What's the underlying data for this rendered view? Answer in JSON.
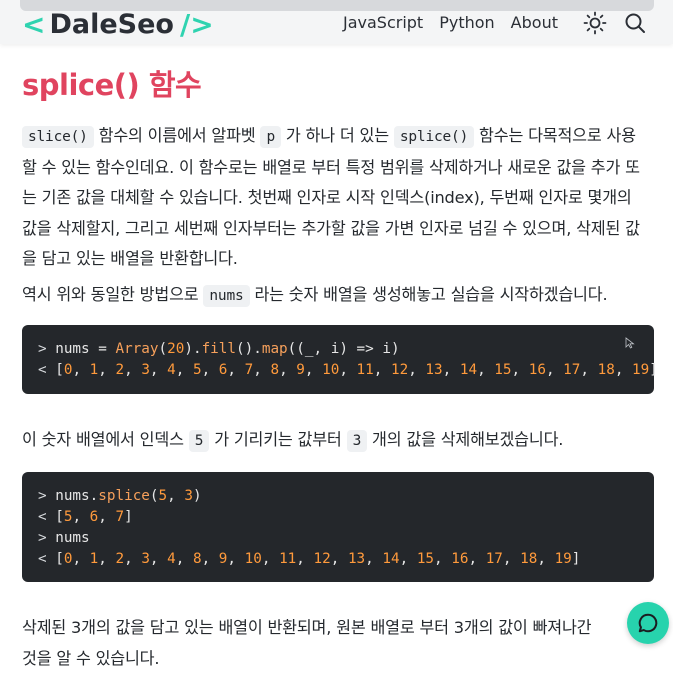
{
  "header": {
    "logo": {
      "left_bracket": "<",
      "name": "DaleSeo",
      "right_bracket": "/>"
    },
    "nav": [
      "JavaScript",
      "Python",
      "About"
    ],
    "icons": [
      "sun-icon",
      "search-icon"
    ]
  },
  "article": {
    "title": "splice() 함수",
    "p1": {
      "c1": "slice()",
      "t1": " 함수의 이름에서 알파벳 ",
      "c2": "p",
      "t2": " 가 하나 더 있는 ",
      "c3": "splice()",
      "t3": " 함수는 다목적으로 사용할 수 있는 함수인데요. 이 함수로는 배열로 부터 특정 범위를 삭제하거나 새로운 값을 추가 또는 기존 값을 대체할 수 있습니다. 첫번째 인자로 시작 인덱스(index), 두번째 인자로 몇개의 값을 삭제할지, 그리고 세번째 인자부터는 추가할 값을 가변 인자로 넘길 수 있으며, 삭제된 값을 담고 있는 배열을 반환합니다."
    },
    "p2": {
      "t1": "역시 위와 동일한 방법으로 ",
      "c1": "nums",
      "t2": " 라는 숫자 배열을 생성해놓고 실습을 시작하겠습니다."
    },
    "code1": {
      "line1": {
        "prompt": "> ",
        "var": "nums",
        "eq": " = ",
        "fn1": "Array",
        "p_open": "(",
        "n": "20",
        "p_close": ").",
        "fn2": "fill",
        "mid": "().",
        "fn3": "map",
        "args": "((_, i) ",
        "arrow": "=>",
        "ret": " i)"
      },
      "line2": {
        "prompt": "< ",
        "values": [
          "0",
          "1",
          "2",
          "3",
          "4",
          "5",
          "6",
          "7",
          "8",
          "9",
          "10",
          "11",
          "12",
          "13",
          "14",
          "15",
          "16",
          "17",
          "18",
          "19"
        ]
      }
    },
    "p3": {
      "t1": "이 숫자 배열에서 인덱스 ",
      "c1": "5",
      "t2": " 가 기리키는 값부터 ",
      "c2": "3",
      "t3": " 개의 값을 삭제해보겠습니다."
    },
    "code2": {
      "line1": {
        "prompt": "> ",
        "var": "nums.",
        "fn": "splice",
        "open": "(",
        "a1": "5",
        "sep": ", ",
        "a2": "3",
        "close": ")"
      },
      "line2": {
        "prompt": "< ",
        "values": [
          "5",
          "6",
          "7"
        ]
      },
      "line3": {
        "prompt": "> ",
        "text": "nums"
      },
      "line4": {
        "prompt": "< ",
        "values": [
          "0",
          "1",
          "2",
          "3",
          "4",
          "8",
          "9",
          "10",
          "11",
          "12",
          "13",
          "14",
          "15",
          "16",
          "17",
          "18",
          "19"
        ]
      }
    },
    "p4": {
      "line1": "삭제된 3개의 값을 담고 있는 배열이 반환되며, 원본 배열로 부터 3개의 값이 빠져나간",
      "line2": "것을 알 수 있습니다."
    }
  },
  "colors": {
    "accent": "#e0445f",
    "brand": "#2fd3b0",
    "fab": "#27d3ad",
    "code_bg": "#24272b",
    "number": "#ff9a3c"
  }
}
